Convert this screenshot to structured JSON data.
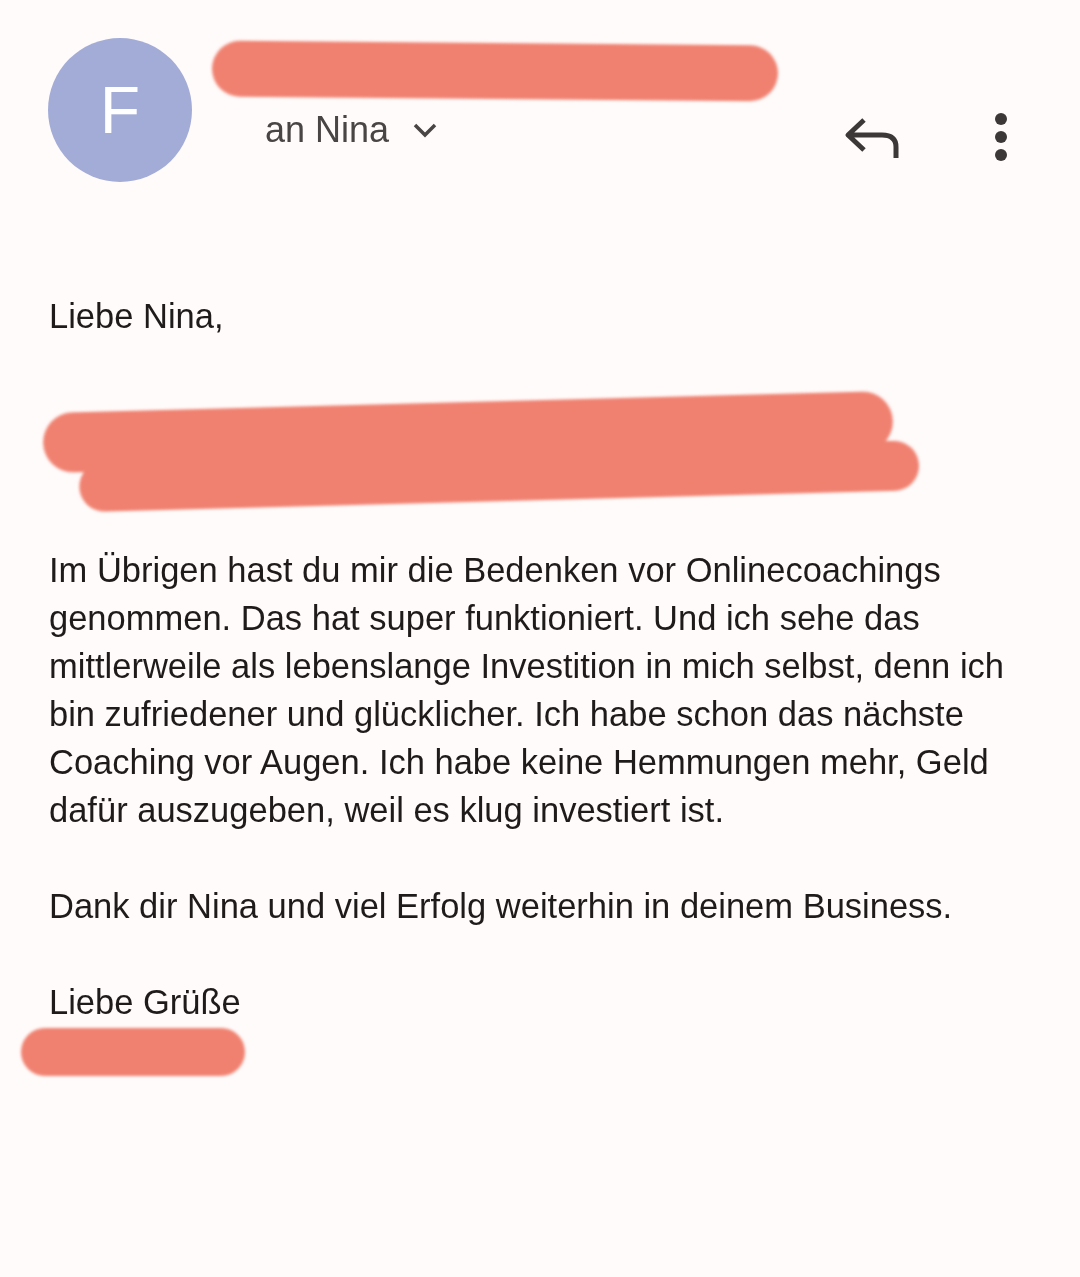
{
  "header": {
    "avatar_letter": "F",
    "recipient": "an Nina"
  },
  "body": {
    "greeting": "Liebe Nina,",
    "paragraphs": [
      "Im Übrigen hast du mir die Bedenken vor Onlinecoachings genommen. Das hat super funktioniert. Und ich sehe das mittlerweile als lebenslange Investition in mich selbst, denn ich bin zufriedener und glücklicher. Ich habe schon das nächste Coaching vor Augen. Ich habe keine Hemmungen mehr, Geld dafür auszugeben, weil es klug investiert ist.",
      "Dank dir Nina und viel Erfolg weiterhin in deinem Business."
    ],
    "closing": "Liebe Grüße"
  }
}
